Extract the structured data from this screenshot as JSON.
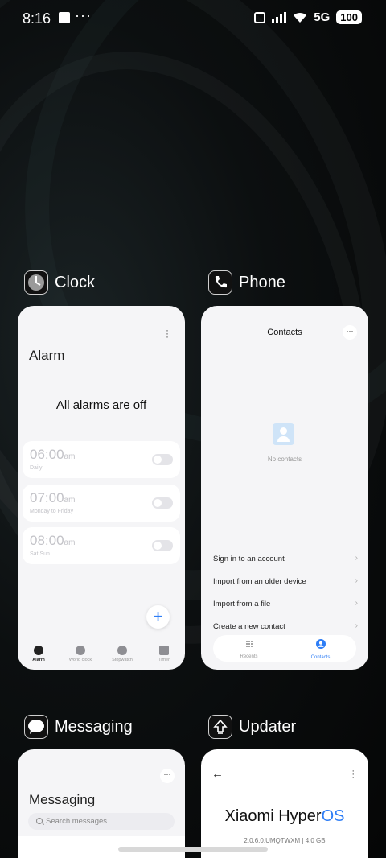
{
  "status_bar": {
    "time": "8:16",
    "network": "5G",
    "battery": "100"
  },
  "cards": {
    "clock": {
      "app_name": "Clock",
      "title": "Alarm",
      "status": "All alarms are off",
      "alarms": [
        {
          "time": "06:00",
          "ampm": "am",
          "repeat": "Daily",
          "enabled": false
        },
        {
          "time": "07:00",
          "ampm": "am",
          "repeat": "Monday to Friday",
          "enabled": false
        },
        {
          "time": "08:00",
          "ampm": "am",
          "repeat": "Sat Sun",
          "enabled": false
        }
      ],
      "add_button": "+",
      "tabs": [
        "Alarm",
        "World clock",
        "Stopwatch",
        "Timer"
      ],
      "active_tab": "Alarm"
    },
    "phone": {
      "app_name": "Phone",
      "title": "Contacts",
      "empty_text": "No contacts",
      "options": [
        "Sign in to an account",
        "Import from an older device",
        "Import from a file",
        "Create a new contact"
      ],
      "tabs": [
        "Recents",
        "Contacts"
      ],
      "active_tab": "Contacts"
    },
    "messaging": {
      "app_name": "Messaging",
      "title": "Messaging",
      "search_placeholder": "Search messages"
    },
    "updater": {
      "app_name": "Updater",
      "brand": "Xiaomi Hyper",
      "brand_accent": "OS",
      "version": "2.0.6.0.UMQTWXM | 4.0 GB"
    }
  },
  "colors": {
    "accent_blue": "#2d7df6",
    "card_bg": "#f5f5f7"
  }
}
